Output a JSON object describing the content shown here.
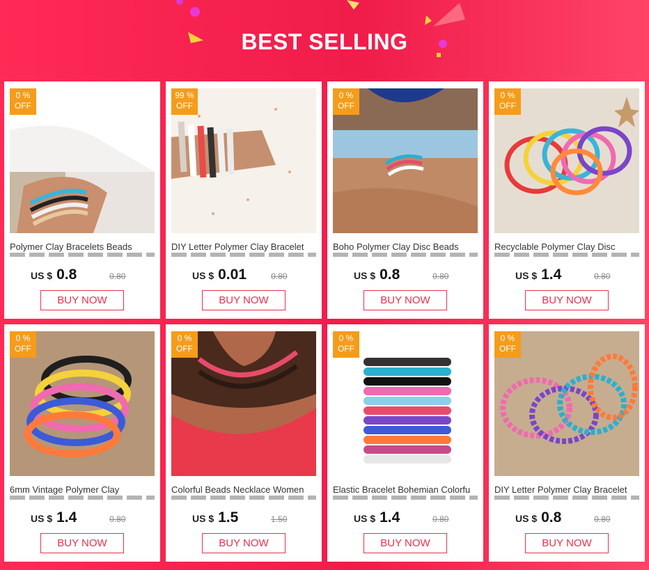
{
  "header": {
    "title": "BEST SELLING"
  },
  "colors": {
    "accent": "#f01c4a",
    "badge": "#f59c1a",
    "button_border": "#e8304f"
  },
  "products": [
    {
      "discount": "0  %",
      "off": "OFF",
      "name": "Polymer Clay Bracelets  Beads",
      "currency": "US $",
      "price": "0.8",
      "old_price": "0.80",
      "button": "BUY NOW"
    },
    {
      "discount": "99  %",
      "off": "OFF",
      "name": "DIY Letter Polymer Clay Bracelet",
      "currency": "US $",
      "price": "0.01",
      "old_price": "0.80",
      "button": "BUY NOW"
    },
    {
      "discount": "0  %",
      "off": "OFF",
      "name": "Boho  Polymer Clay Disc Beads",
      "currency": "US $",
      "price": "0.8",
      "old_price": "0.80",
      "button": "BUY NOW"
    },
    {
      "discount": "0  %",
      "off": "OFF",
      "name": "Recyclable Polymer Clay Disc",
      "currency": "US $",
      "price": "1.4",
      "old_price": "0.80",
      "button": "BUY NOW"
    },
    {
      "discount": "0  %",
      "off": "OFF",
      "name": "6mm Vintage Polymer Clay",
      "currency": "US $",
      "price": "1.4",
      "old_price": "0.80",
      "button": "BUY NOW"
    },
    {
      "discount": "0  %",
      "off": "OFF",
      "name": "Colorful Beads Necklace Women",
      "currency": "US $",
      "price": "1.5",
      "old_price": "1.50",
      "button": "BUY NOW"
    },
    {
      "discount": "0  %",
      "off": "OFF",
      "name": "Elastic Bracelet Bohemian Colorfu",
      "currency": "US $",
      "price": "1.4",
      "old_price": "0.80",
      "button": "BUY NOW"
    },
    {
      "discount": "0  %",
      "off": "OFF",
      "name": "DIY Letter Polymer Clay Bracelet",
      "currency": "US $",
      "price": "0.8",
      "old_price": "0.80",
      "button": "BUY NOW"
    }
  ]
}
